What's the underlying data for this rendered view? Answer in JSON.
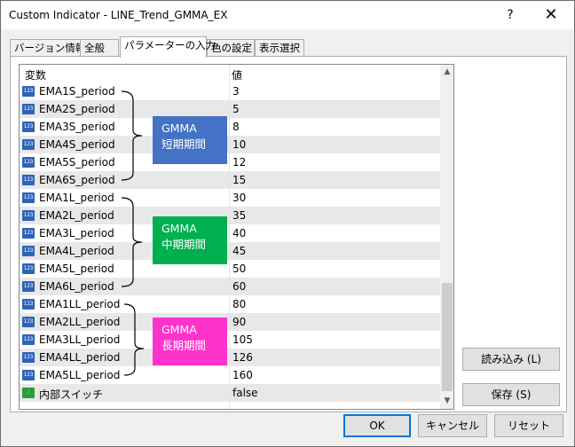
{
  "window": {
    "title": "Custom Indicator - LINE_Trend_GMMA_EX",
    "help_label": "?",
    "close_label": "✕"
  },
  "tabs": [
    {
      "label": "バージョン情報",
      "active": false
    },
    {
      "label": "全般",
      "active": false
    },
    {
      "label": "パラメーターの入力",
      "active": true
    },
    {
      "label": "色の設定",
      "active": false
    },
    {
      "label": "表示選択",
      "active": false
    }
  ],
  "grid": {
    "header_variable": "変数",
    "header_value": "値",
    "rows": [
      {
        "name": "EMA1S_period",
        "value": "3",
        "icon": "123"
      },
      {
        "name": "EMA2S_period",
        "value": "5",
        "icon": "123"
      },
      {
        "name": "EMA3S_period",
        "value": "8",
        "icon": "123"
      },
      {
        "name": "EMA4S_period",
        "value": "10",
        "icon": "123"
      },
      {
        "name": "EMA5S_period",
        "value": "12",
        "icon": "123"
      },
      {
        "name": "EMA6S_period",
        "value": "15",
        "icon": "123"
      },
      {
        "name": "EMA1L_period",
        "value": "30",
        "icon": "123"
      },
      {
        "name": "EMA2L_period",
        "value": "35",
        "icon": "123"
      },
      {
        "name": "EMA3L_period",
        "value": "40",
        "icon": "123"
      },
      {
        "name": "EMA4L_period",
        "value": "45",
        "icon": "123"
      },
      {
        "name": "EMA5L_period",
        "value": "50",
        "icon": "123"
      },
      {
        "name": "EMA6L_period",
        "value": "60",
        "icon": "123"
      },
      {
        "name": "EMA1LL_period",
        "value": "80",
        "icon": "123"
      },
      {
        "name": "EMA2LL_period",
        "value": "90",
        "icon": "123"
      },
      {
        "name": "EMA3LL_period",
        "value": "105",
        "icon": "123"
      },
      {
        "name": "EMA4LL_period",
        "value": "126",
        "icon": "123"
      },
      {
        "name": "EMA5LL_period",
        "value": "160",
        "icon": "123"
      },
      {
        "name": "内部スイッチ",
        "value": "false",
        "icon": "switch"
      }
    ],
    "groups": {
      "short": {
        "line1": "GMMA",
        "line2": "短期期間",
        "color": "#4472c4"
      },
      "mid": {
        "line1": "GMMA",
        "line2": "中期期間",
        "color": "#00b050"
      },
      "long": {
        "line1": "GMMA",
        "line2": "長期期間",
        "color": "#ff33cc"
      }
    }
  },
  "buttons": {
    "load": "読み込み (L)",
    "save": "保存 (S)",
    "ok": "OK",
    "cancel": "キャンセル",
    "reset": "リセット"
  }
}
